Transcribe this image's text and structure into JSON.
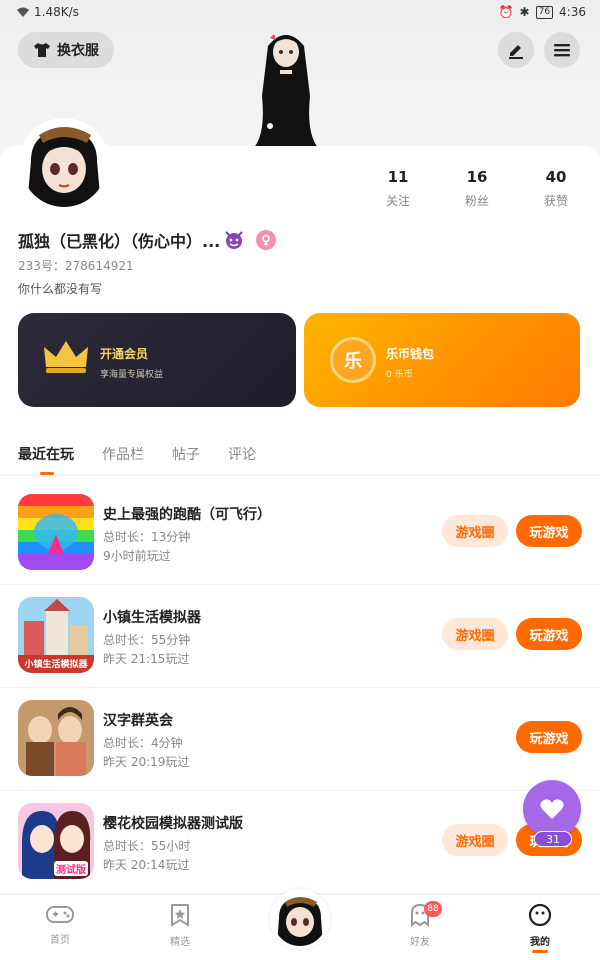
{
  "status_bar": {
    "speed": "1.48K/s",
    "battery": "76",
    "time": "4:36"
  },
  "header": {
    "outfit_label": "换衣服",
    "edit_icon": "edit-icon",
    "menu_icon": "menu-icon"
  },
  "profile": {
    "stats": [
      {
        "value": "11",
        "label": "关注"
      },
      {
        "value": "16",
        "label": "粉丝"
      },
      {
        "value": "40",
        "label": "获赞"
      }
    ],
    "username": "孤独（已黑化）（伤心中）...",
    "uid": "233号：278614921",
    "bio": "你什么都没有写"
  },
  "cards": {
    "vip": {
      "title": "开通会员",
      "subtitle": "享海量专属权益"
    },
    "wallet": {
      "title": "乐币钱包",
      "subtitle": "0 乐币",
      "coin_char": "乐"
    }
  },
  "tabs": [
    {
      "label": "最近在玩",
      "active": true
    },
    {
      "label": "作品栏",
      "active": false
    },
    {
      "label": "帖子",
      "active": false
    },
    {
      "label": "评论",
      "active": false
    }
  ],
  "games": [
    {
      "title": "史上最强的跑酷（可飞行）",
      "duration": "总时长：13分钟",
      "last_played": "9小时前玩过",
      "circle_label": "游戏圈",
      "play_label": "玩游戏",
      "has_circle": true
    },
    {
      "title": "小镇生活模拟器",
      "duration": "总时长：55分钟",
      "last_played": "昨天 21:15玩过",
      "circle_label": "游戏圈",
      "play_label": "玩游戏",
      "has_circle": true,
      "icon_caption": "小镇生活模拟器"
    },
    {
      "title": "汉字群英会",
      "duration": "总时长：4分钟",
      "last_played": "昨天 20:19玩过",
      "circle_label": "",
      "play_label": "玩游戏",
      "has_circle": false
    },
    {
      "title": "樱花校园模拟器测试版",
      "duration": "总时长：55小时",
      "last_played": "昨天 20:14玩过",
      "circle_label": "游戏圈",
      "play_label": "玩游戏",
      "has_circle": true,
      "icon_caption": "测试版"
    }
  ],
  "float_like": {
    "count": "31"
  },
  "bottom_nav": {
    "items": [
      {
        "label": "首页",
        "icon": "gamepad-icon"
      },
      {
        "label": "精选",
        "icon": "star-bookmark-icon"
      },
      {
        "label": "好友",
        "icon": "ghost-icon",
        "badge": "88"
      },
      {
        "label": "我的",
        "icon": "smiley-icon",
        "active": true
      }
    ]
  },
  "colors": {
    "accent": "#ff6a00",
    "vip_gold": "#f5d36a",
    "like_purple": "#a569e8"
  }
}
